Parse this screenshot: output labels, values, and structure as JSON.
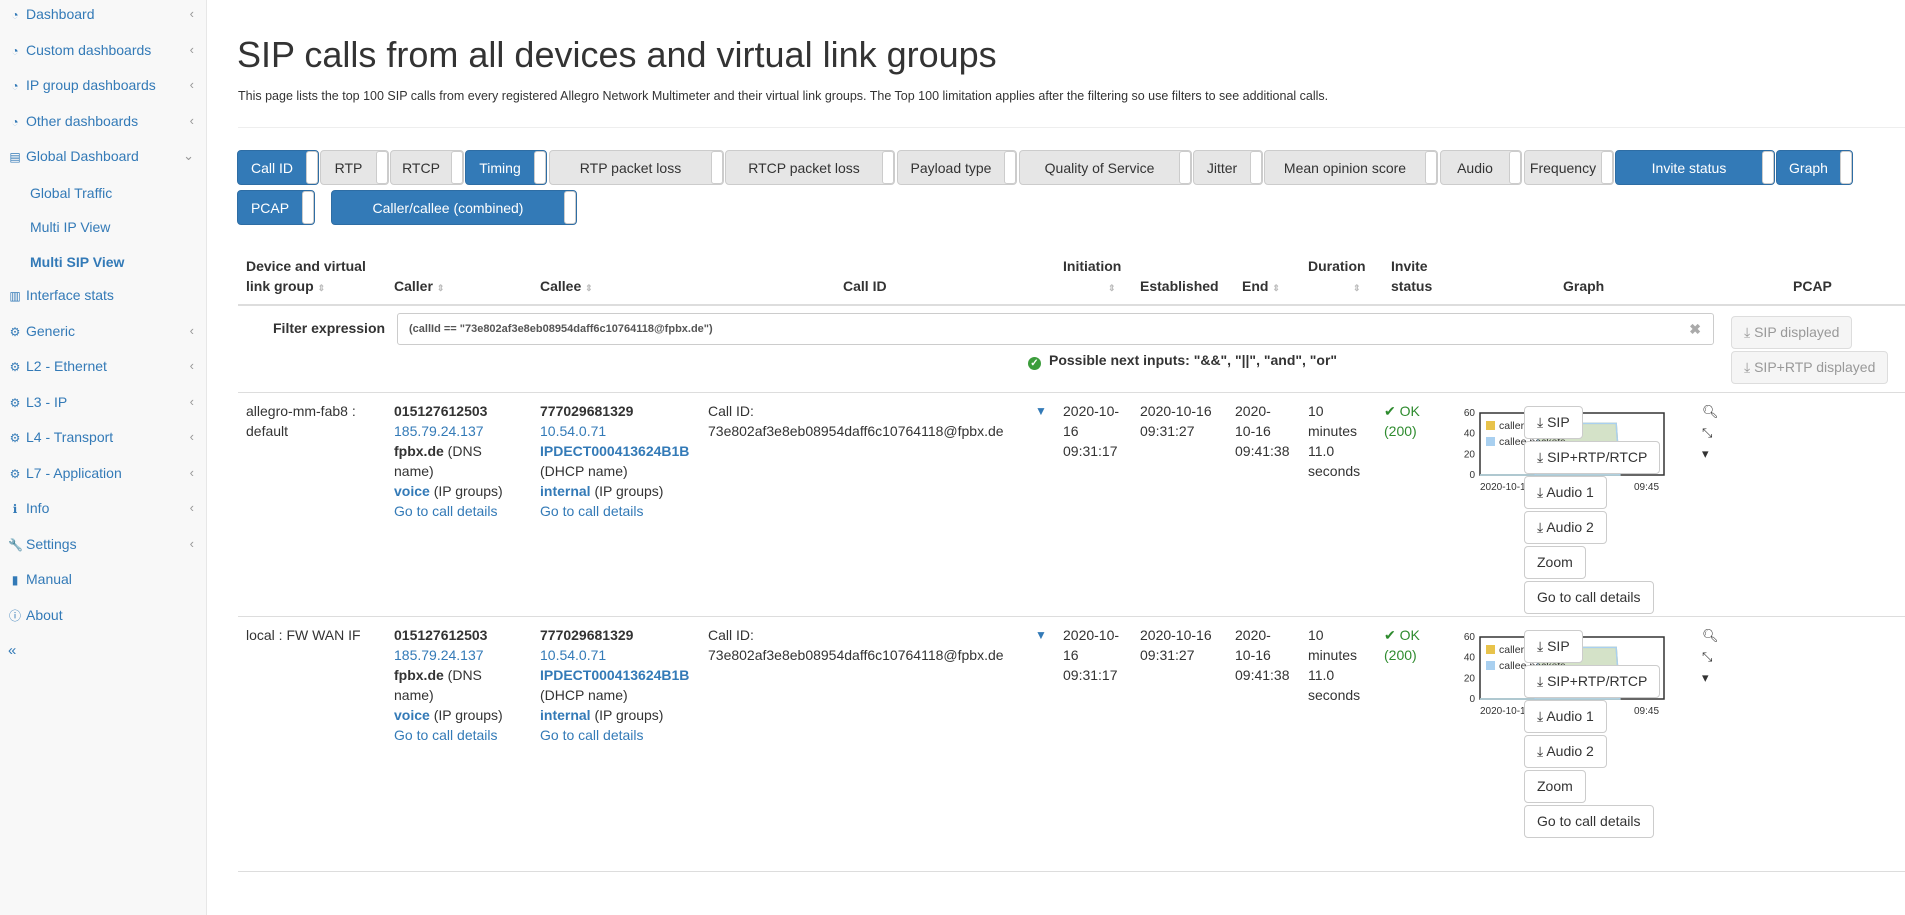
{
  "sidebar": {
    "items": [
      {
        "label": "Dashboard",
        "icon": "dashboard-icon",
        "chev": "‹"
      },
      {
        "label": "Custom dashboards",
        "icon": "dashboard-icon",
        "chev": "‹"
      },
      {
        "label": "IP group dashboards",
        "icon": "dashboard-icon",
        "chev": "‹"
      },
      {
        "label": "Other dashboards",
        "icon": "dashboard-icon",
        "chev": "‹"
      },
      {
        "label": "Global Dashboard",
        "icon": "table-icon",
        "chev": "⌄"
      }
    ],
    "subitems": [
      {
        "label": "Global Traffic"
      },
      {
        "label": "Multi IP View"
      },
      {
        "label": "Multi SIP View"
      }
    ],
    "items2": [
      {
        "label": "Interface stats",
        "icon": "bar-chart-icon",
        "chev": ""
      },
      {
        "label": "Generic",
        "icon": "gear-icon",
        "chev": "‹"
      },
      {
        "label": "L2 - Ethernet",
        "icon": "gear-icon",
        "chev": "‹"
      },
      {
        "label": "L3 - IP",
        "icon": "gear-icon",
        "chev": "‹"
      },
      {
        "label": "L4 - Transport",
        "icon": "gear-icon",
        "chev": "‹"
      },
      {
        "label": "L7 - Application",
        "icon": "gear-icon",
        "chev": "‹"
      },
      {
        "label": "Info",
        "icon": "info-icon",
        "chev": "‹"
      },
      {
        "label": "Settings",
        "icon": "wrench-icon",
        "chev": "‹"
      },
      {
        "label": "Manual",
        "icon": "book-icon",
        "chev": ""
      },
      {
        "label": "About",
        "icon": "info-circle-icon",
        "chev": ""
      }
    ],
    "collapse": "«"
  },
  "page": {
    "title": "SIP calls from all devices and virtual link groups",
    "description": "This page lists the top 100 SIP calls from every registered Allegro Network Multimeter and their virtual link groups. The Top 100 limitation applies after the filtering so use filters to see additional calls."
  },
  "toggles": [
    {
      "label": "Call ID",
      "on": true
    },
    {
      "label": "RTP",
      "on": false
    },
    {
      "label": "RTCP",
      "on": false
    },
    {
      "label": "Timing",
      "on": true
    },
    {
      "label": "RTP packet loss",
      "on": false
    },
    {
      "label": "RTCP packet loss",
      "on": false
    },
    {
      "label": "Payload type",
      "on": false
    },
    {
      "label": "Quality of Service",
      "on": false
    },
    {
      "label": "Jitter",
      "on": false
    },
    {
      "label": "Mean opinion score",
      "on": false
    },
    {
      "label": "Audio",
      "on": false
    },
    {
      "label": "Frequency",
      "on": false
    },
    {
      "label": "Invite status",
      "on": true
    },
    {
      "label": "Graph",
      "on": true
    },
    {
      "label": "PCAP",
      "on": true
    },
    {
      "label": "Caller/callee (combined)",
      "on": true
    }
  ],
  "columns": {
    "device_l1": "Device and virtual",
    "device_l2": "link group",
    "caller": "Caller",
    "callee": "Callee",
    "callid": "Call ID",
    "initiation": "Initiation",
    "established": "Established",
    "end": "End",
    "duration": "Duration",
    "invite_l1": "Invite",
    "invite_l2": "status",
    "graph": "Graph",
    "pcap": "PCAP"
  },
  "filter": {
    "label": "Filter expression",
    "value": "(callId == \"73e802af3e8eb08954daff6c10764118@fpbx.de\")",
    "clear": "✖",
    "hint": "Possible next inputs: \"&&\", \"||\", \"and\", \"or\"",
    "sip_displayed": "SIP displayed",
    "siprtp_displayed": "SIP+RTP displayed"
  },
  "rows": [
    {
      "device_l1": "allegro-mm-fab8 :",
      "device_l2": "default",
      "caller_num": "015127612503",
      "caller_ip": "185.79.24.137",
      "caller_dns": "fpbx.de",
      "caller_dns_suffix": " (DNS",
      "caller_dns_suffix2": "name)",
      "caller_group": "voice",
      "caller_group_suffix": " (IP groups)",
      "caller_details": "Go to call details",
      "callee_num": "777029681329",
      "callee_ip": "10.54.0.71",
      "callee_dhcp": "IPDECT000413624B1B",
      "callee_dhcp_suffix": "(DHCP name)",
      "callee_group": "internal",
      "callee_group_suffix": " (IP groups)",
      "callee_details": "Go to call details",
      "callid_label": "Call ID:",
      "callid": "73e802af3e8eb08954daff6c10764118@fpbx.de",
      "init_l1": "2020-10-",
      "init_l2": "16",
      "init_l3": "09:31:17",
      "est_l1": "2020-10-16",
      "est_l2": "09:31:27",
      "end_l1": "2020-",
      "end_l2": "10-16",
      "end_l3": "09:41:38",
      "dur_l1": "10",
      "dur_l2": "minutes",
      "dur_l3": "11.0",
      "dur_l4": "seconds",
      "invite_l1": "OK",
      "invite_l2": "(200)",
      "btn_sip": "SIP",
      "btn_siprtp": "SIP+RTP/RTCP",
      "btn_audio1": "Audio 1",
      "btn_audio2": "Audio 2",
      "btn_zoom": "Zoom",
      "btn_details": "Go to call details"
    },
    {
      "device_l1": "local : FW WAN IF",
      "device_l2": "",
      "caller_num": "015127612503",
      "caller_ip": "185.79.24.137",
      "caller_dns": "fpbx.de",
      "caller_dns_suffix": " (DNS",
      "caller_dns_suffix2": "name)",
      "caller_group": "voice",
      "caller_group_suffix": " (IP groups)",
      "caller_details": "Go to call details",
      "callee_num": "777029681329",
      "callee_ip": "10.54.0.71",
      "callee_dhcp": "IPDECT000413624B1B",
      "callee_dhcp_suffix": "(DHCP name)",
      "callee_group": "internal",
      "callee_group_suffix": " (IP groups)",
      "callee_details": "Go to call details",
      "callid_label": "Call ID:",
      "callid": "73e802af3e8eb08954daff6c10764118@fpbx.de",
      "init_l1": "2020-10-",
      "init_l2": "16",
      "init_l3": "09:31:17",
      "est_l1": "2020-10-16",
      "est_l2": "09:31:27",
      "end_l1": "2020-",
      "end_l2": "10-16",
      "end_l3": "09:41:38",
      "dur_l1": "10",
      "dur_l2": "minutes",
      "dur_l3": "11.0",
      "dur_l4": "seconds",
      "invite_l1": "OK",
      "invite_l2": "(200)",
      "btn_sip": "SIP",
      "btn_siprtp": "SIP+RTP/RTCP",
      "btn_audio1": "Audio 1",
      "btn_audio2": "Audio 2",
      "btn_zoom": "Zoom",
      "btn_details": "Go to call details"
    }
  ],
  "chart_data": [
    {
      "type": "area",
      "series": [
        {
          "name": "caller packets",
          "color": "#e8c34b",
          "values": [
            0,
            0,
            50,
            50,
            0
          ]
        },
        {
          "name": "callee packets",
          "color": "#a9d0f0",
          "values": [
            0,
            0,
            50,
            50,
            0
          ]
        }
      ],
      "yticks": [
        "0",
        "20",
        "40",
        "60"
      ],
      "ylim": [
        0,
        60
      ],
      "xticks": [
        "2020-10-16 09:30",
        "09:45"
      ]
    },
    {
      "type": "area",
      "series": [
        {
          "name": "caller packets",
          "color": "#e8c34b",
          "values": [
            0,
            0,
            50,
            50,
            0
          ]
        },
        {
          "name": "callee packets",
          "color": "#a9d0f0",
          "values": [
            0,
            0,
            50,
            50,
            0
          ]
        }
      ],
      "yticks": [
        "0",
        "20",
        "40",
        "60"
      ],
      "ylim": [
        0,
        60
      ],
      "xticks": [
        "2020-10-16 09:30",
        "09:45"
      ]
    }
  ],
  "colors": {
    "accent": "#337ab7",
    "ok": "#2e8b2e"
  }
}
